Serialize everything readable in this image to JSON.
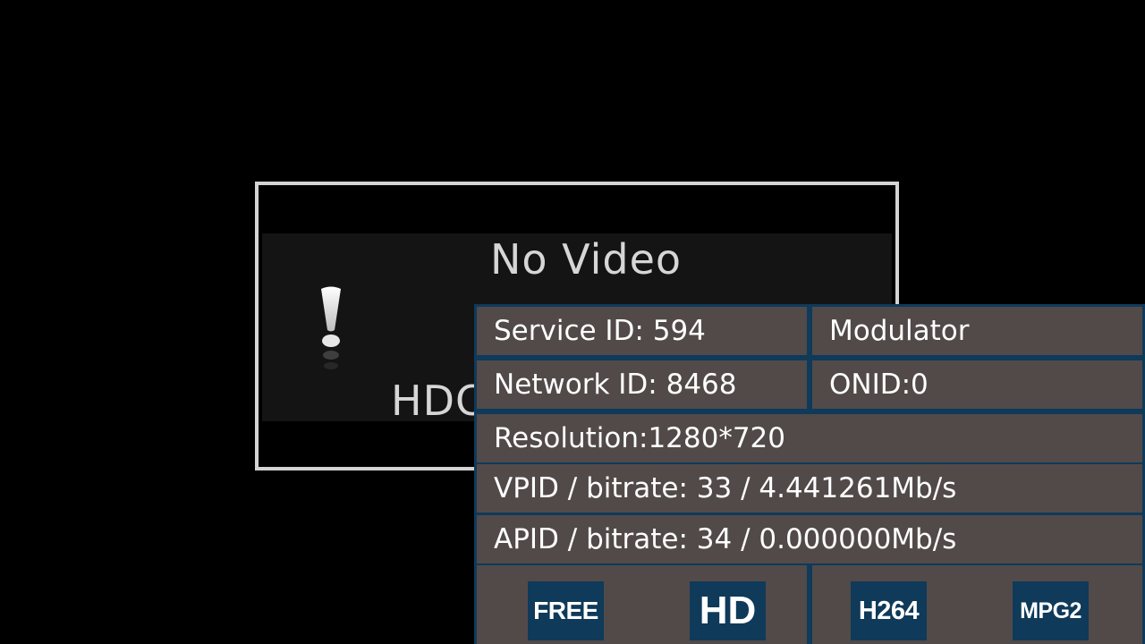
{
  "no_video_dialog": {
    "title": "No Video",
    "reason": "HDCP",
    "icon": "exclamation-icon"
  },
  "channel_info": {
    "service_id": "Service ID: 594",
    "modulator": "Modulator",
    "network_id": "Network ID: 8468",
    "onid": "ONID:0",
    "resolution_label": "Resolution:",
    "resolution_value": "1280*720",
    "vpid": "VPID / bitrate: 33 / 4.441261Mb/s",
    "apid": "APID / bitrate: 34 / 0.000000Mb/s",
    "badges_left": [
      "FREE",
      "HD"
    ],
    "badges_right": [
      "H264",
      "MPG2"
    ]
  },
  "colors": {
    "background": "#000000",
    "dialog_border": "#d4d4d4",
    "dialog_fill": "#141414",
    "dialog_text": "#d6d6d6",
    "panel_border": "#0f3a5a",
    "cell_fill": "#514a49",
    "cell_text": "#ffffff",
    "badge_fill": "#0f3a5a"
  }
}
